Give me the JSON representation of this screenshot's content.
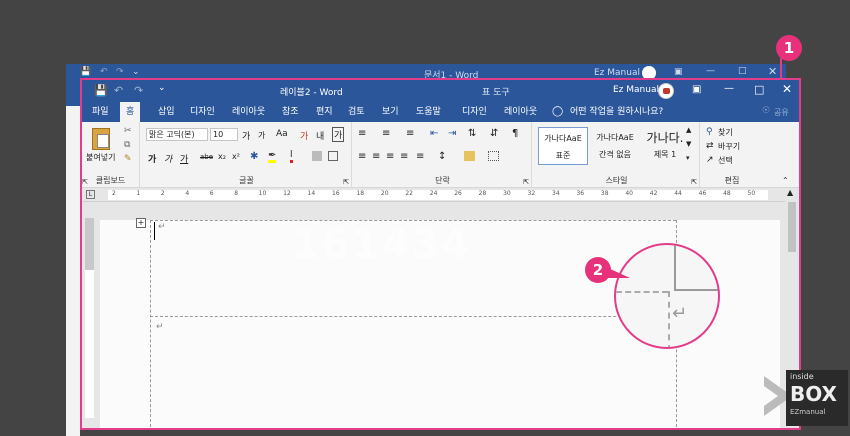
{
  "background_window": {
    "title": "문서1 - Word",
    "user": "Ez Manual"
  },
  "window": {
    "title": "레이블2 - Word",
    "context_tab_title": "표 도구",
    "user": "Ez Manual",
    "share": "공유"
  },
  "tabs": [
    "파일",
    "홈",
    "삽입",
    "디자인",
    "레이아웃",
    "참조",
    "편지",
    "검토",
    "보기",
    "도움말",
    "디자인",
    "레이아웃"
  ],
  "tell_me": "어떤 작업을 원하시나요?",
  "ribbon": {
    "clipboard": {
      "paste": "붙여넣기",
      "label": "클립보드"
    },
    "font": {
      "name": "맑은 고딕(본)",
      "size": "10",
      "label": "글꼴",
      "grow": "가",
      "shrink": "가",
      "aa": "Aa",
      "clear": "가",
      "phonetic": "내",
      "border": "가",
      "bold": "가",
      "italic": "가",
      "underline": "가",
      "strike": "abe",
      "sub": "x₂",
      "sup": "x²"
    },
    "paragraph": {
      "label": "단락"
    },
    "styles": {
      "label": "스타일",
      "items": [
        {
          "sample": "가나다AaE",
          "name": "표준"
        },
        {
          "sample": "가나다AaE",
          "name": "간격 없음"
        },
        {
          "sample": "가나다.",
          "name": "제목 1"
        }
      ]
    },
    "editing": {
      "find": "찾기",
      "replace": "바꾸기",
      "select": "선택",
      "label": "편집"
    }
  },
  "ruler": {
    "marks": [
      "2",
      "1",
      "2",
      "4",
      "6",
      "8",
      "10",
      "12",
      "14",
      "16",
      "18",
      "20",
      "22",
      "24",
      "26",
      "28",
      "30",
      "32",
      "34",
      "36",
      "38",
      "40",
      "42",
      "44",
      "46",
      "48",
      "50"
    ]
  },
  "overlay": {
    "badge1": "1",
    "badge2": "2",
    "watermark": "161434"
  },
  "logo": {
    "line1": "inside",
    "line2": "BOX",
    "line3": "EZmanual"
  }
}
